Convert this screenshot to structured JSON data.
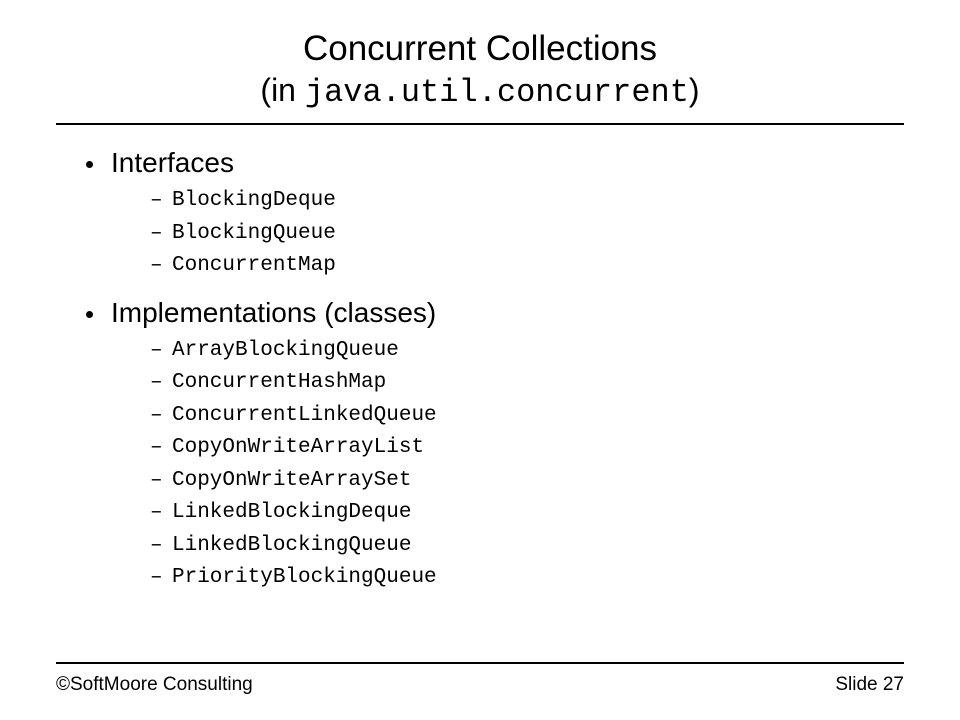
{
  "title": {
    "line1": "Concurrent Collections",
    "line2_prefix": "(in ",
    "line2_code": "java.util.concurrent",
    "line2_suffix": ")"
  },
  "sections": [
    {
      "heading": "Interfaces",
      "items": [
        "BlockingDeque",
        "BlockingQueue",
        "ConcurrentMap"
      ]
    },
    {
      "heading": "Implementations (classes)",
      "items": [
        "ArrayBlockingQueue",
        "ConcurrentHashMap",
        "ConcurrentLinkedQueue",
        "CopyOnWriteArrayList",
        "CopyOnWriteArraySet",
        "LinkedBlockingDeque",
        "LinkedBlockingQueue",
        "PriorityBlockingQueue"
      ]
    }
  ],
  "footer": {
    "left": "©SoftMoore Consulting",
    "right": "Slide 27"
  }
}
